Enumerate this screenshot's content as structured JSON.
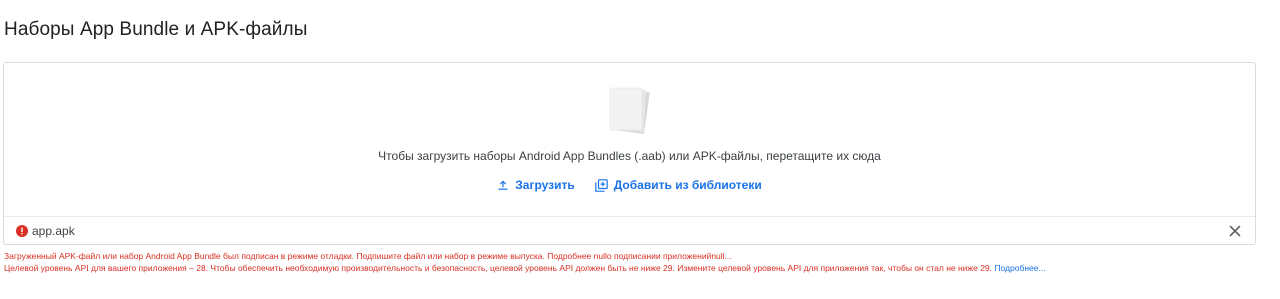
{
  "section": {
    "title": "Наборы App Bundle и APK-файлы"
  },
  "dropzone": {
    "illustration_icon": "document-stack-icon",
    "text": "Чтобы загрузить наборы Android App Bundles (.aab) или APK-файлы, перетащите их сюда",
    "upload_label": "Загрузить",
    "upload_icon": "upload-icon",
    "library_label": "Добавить из библиотеки",
    "library_icon": "add-to-library-icon",
    "accent_color": "#1a73e8"
  },
  "file": {
    "name": "app.apk",
    "status_icon": "error-icon",
    "status_color": "#d93025",
    "remove_icon": "close-icon"
  },
  "errors": [
    {
      "text": "Загруженный APK-файл или набор Android App Bundle был подписан в режиме отладки. Подпишите файл или набор в режиме выпуска. Подробнее nullo подписании приложенийnull..."
    },
    {
      "text": "Целевой уровень API для вашего приложения – 28. Чтобы обеспечить необходимую производительность и безопасность, целевой уровень API должен быть не ниже 29. Измените целевой уровень API для приложения так, чтобы он стал не ниже 29.",
      "link": "Подробнее..."
    }
  ]
}
